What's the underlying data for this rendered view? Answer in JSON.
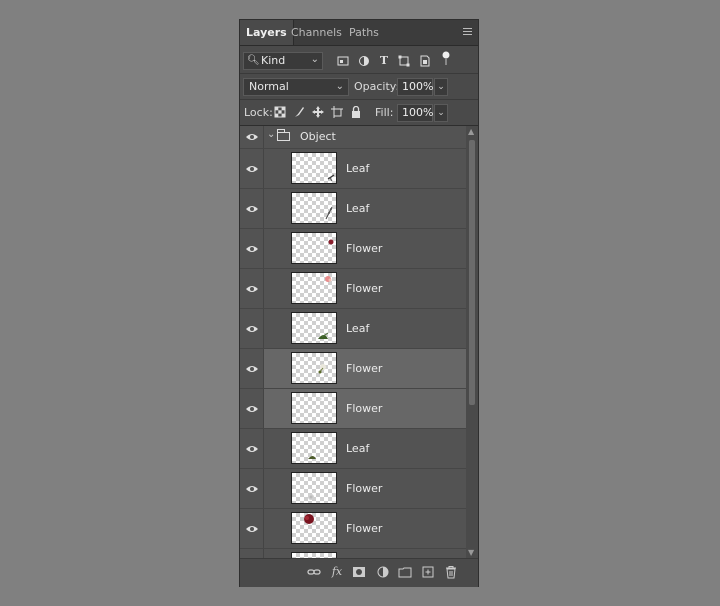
{
  "tabs": [
    {
      "label": "Layers",
      "active": true
    },
    {
      "label": "Channels",
      "active": false
    },
    {
      "label": "Paths",
      "active": false
    }
  ],
  "filter": {
    "kind_label": "Kind",
    "icons": [
      "pixel-filter-icon",
      "adjustment-filter-icon",
      "type-filter-icon",
      "shape-filter-icon",
      "smart-object-filter-icon",
      "filter-toggle-icon"
    ]
  },
  "blend": {
    "mode": "Normal",
    "opacity_label": "Opacity:",
    "opacity_value": "100%"
  },
  "lock": {
    "label": "Lock:",
    "icons": [
      "lock-transparent-icon",
      "lock-image-icon",
      "lock-position-icon",
      "lock-artboard-icon",
      "lock-all-icon"
    ],
    "fill_label": "Fill:",
    "fill_value": "100%"
  },
  "group": {
    "name": "Object"
  },
  "layers": [
    {
      "name": "Leaf",
      "selected": false,
      "art": "leaf-stem"
    },
    {
      "name": "Leaf",
      "selected": false,
      "art": "leaf-sprig"
    },
    {
      "name": "Flower",
      "selected": false,
      "art": "flower-red-small"
    },
    {
      "name": "Flower",
      "selected": false,
      "art": "flower-pink"
    },
    {
      "name": "Leaf",
      "selected": false,
      "art": "leaf-green"
    },
    {
      "name": "Flower",
      "selected": true,
      "art": "flower-white"
    },
    {
      "name": "Flower",
      "selected": true,
      "art": "flower-faint"
    },
    {
      "name": "Leaf",
      "selected": false,
      "art": "leaf-dark"
    },
    {
      "name": "Flower",
      "selected": false,
      "art": "flower-grey"
    },
    {
      "name": "Flower",
      "selected": false,
      "art": "flower-red-large"
    },
    {
      "name": "",
      "selected": false,
      "art": "none"
    }
  ],
  "footer_icons": [
    "link-layers-icon",
    "fx-icon",
    "add-mask-icon",
    "adjustment-layer-icon",
    "new-group-icon",
    "new-layer-icon",
    "trash-icon"
  ],
  "colors": {
    "panel_bg": "#4a4a4a",
    "row_bg": "#535353",
    "selected_bg": "#676767",
    "canvas_bg": "#808080"
  }
}
